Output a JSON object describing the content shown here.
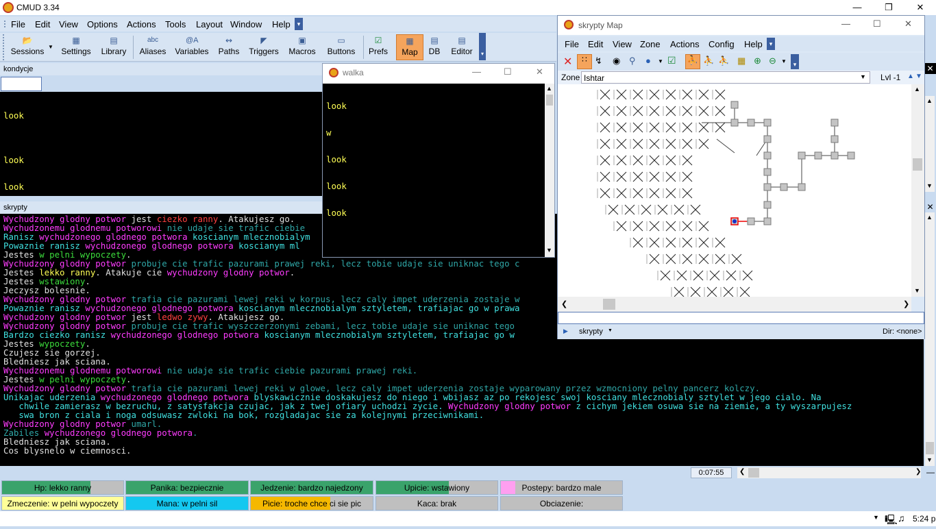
{
  "app": {
    "title": "CMUD 3.34"
  },
  "menu": [
    "File",
    "Edit",
    "View",
    "Options",
    "Actions",
    "Tools",
    "Layout",
    "Window",
    "Help"
  ],
  "toolbar": [
    {
      "label": "Sessions",
      "icon": "folder-icon"
    },
    {
      "label": "Settings",
      "icon": "settings-icon"
    },
    {
      "label": "Library",
      "icon": "library-icon"
    },
    {
      "label": "Aliases",
      "icon": "abc"
    },
    {
      "label": "Variables",
      "icon": "@A"
    },
    {
      "label": "Paths",
      "icon": "paths-icon"
    },
    {
      "label": "Triggers",
      "icon": "gun-icon"
    },
    {
      "label": "Macros",
      "icon": "key-icon"
    },
    {
      "label": "Buttons",
      "icon": "button-icon"
    },
    {
      "label": "Prefs",
      "icon": "check-icon"
    },
    {
      "label": "Map",
      "icon": "map-icon",
      "active": true
    },
    {
      "label": "DB",
      "icon": "db-icon"
    },
    {
      "label": "Editor",
      "icon": "editor-icon"
    }
  ],
  "kondycje": {
    "title": "kondycje",
    "lines": [
      "look",
      "",
      "look",
      "look",
      "look"
    ]
  },
  "walka": {
    "title": "walka",
    "lines": [
      "look",
      "w",
      "look",
      "look",
      "look"
    ]
  },
  "skrypty": {
    "title": "skrypty",
    "lines": [
      [
        [
          "m",
          "Wychudzony glodny potwor"
        ],
        [
          "w",
          " jest "
        ],
        [
          "r",
          "ciezko ranny"
        ],
        [
          "w",
          ". Atakujesz go."
        ]
      ],
      [
        [
          "m",
          "Wychudzonemu glodnemu potworowi"
        ],
        [
          "dc",
          " nie udaje sie trafic ciebie"
        ]
      ],
      [
        [
          "c",
          "Ranisz "
        ],
        [
          "m",
          "wychudzonego glodnego potwora"
        ],
        [
          "c",
          " koscianym mlecznobialym"
        ]
      ],
      [
        [
          "c",
          "Powaznie ranisz "
        ],
        [
          "m",
          "wychudzonego glodnego potwora"
        ],
        [
          "c",
          " koscianym ml"
        ]
      ],
      [
        [
          "w",
          "Jestes "
        ],
        [
          "g",
          "w pelni wypoczety"
        ],
        [
          "w",
          "."
        ]
      ],
      [
        [
          "m",
          "Wychudzony glodny potwor"
        ],
        [
          "dc",
          " probuje cie trafic pazurami prawej reki, lecz tobie udaje sie uniknac tego c"
        ]
      ],
      [
        [
          "w",
          "Jestes "
        ],
        [
          "y",
          "lekko ranny"
        ],
        [
          "w",
          ". Atakuje cie "
        ],
        [
          "m",
          "wychudzony glodny potwor"
        ],
        [
          "w",
          "."
        ]
      ],
      [
        [
          "w",
          "Jestes "
        ],
        [
          "g",
          "wstawiony"
        ],
        [
          "w",
          "."
        ]
      ],
      [
        [
          "w",
          "Jeczysz bolesnie."
        ]
      ],
      [
        [
          "m",
          "Wychudzony glodny potwor"
        ],
        [
          "dc",
          " trafia cie pazurami lewej reki w korpus, lecz caly impet uderzenia zostaje w"
        ]
      ],
      [
        [
          "c",
          "Powaznie ranisz "
        ],
        [
          "m",
          "wychudzonego glodnego potwora"
        ],
        [
          "c",
          " koscianym mlecznobialym sztyletem, trafiajac go w prawa"
        ]
      ],
      [
        [
          "m",
          "Wychudzony glodny potwor"
        ],
        [
          "w",
          " jest "
        ],
        [
          "r",
          "ledwo zywy"
        ],
        [
          "w",
          ". Atakujesz go."
        ]
      ],
      [
        [
          "m",
          "Wychudzony glodny potwor"
        ],
        [
          "dc",
          " probuje cie trafic wyszczerzonymi zebami, lecz tobie udaje sie uniknac tego "
        ]
      ],
      [
        [
          "c",
          "Bardzo ciezko ranisz "
        ],
        [
          "m",
          "wychudzonego glodnego potwora"
        ],
        [
          "c",
          " koscianym mlecznobialym sztyletem, trafiajac go w "
        ]
      ],
      [
        [
          "w",
          "Jestes "
        ],
        [
          "g",
          "wypoczety"
        ],
        [
          "w",
          "."
        ]
      ],
      [
        [
          "w",
          "Czujesz sie gorzej."
        ]
      ],
      [
        [
          "w",
          "Bledniesz jak sciana."
        ]
      ],
      [
        [
          "m",
          "Wychudzonemu glodnemu potworowi"
        ],
        [
          "dc",
          " nie udaje sie trafic ciebie pazurami prawej reki."
        ]
      ],
      [
        [
          "w",
          "Jestes "
        ],
        [
          "g",
          "w pelni wypoczety"
        ],
        [
          "w",
          "."
        ]
      ],
      [
        [
          "m",
          "Wychudzony glodny potwor"
        ],
        [
          "dc",
          " trafia cie pazurami lewej reki w glowe, lecz caly impet uderzenia zostaje wyparowany przez wzmocniony pelny pancerz kolczy."
        ]
      ],
      [
        [
          "c",
          "Unikajac uderzenia "
        ],
        [
          "m",
          "wychudzonego glodnego potwora"
        ],
        [
          "c",
          " blyskawicznie doskakujesz do niego i wbijasz az po rekojesc swoj kosciany mlecznobialy sztylet w jego cialo. Na"
        ]
      ],
      [
        [
          "c",
          "   chwile zamierasz w bezruchu, z satysfakcja czujac, jak z twej ofiary uchodzi zycie. "
        ],
        [
          "m",
          "Wychudzony glodny potwor"
        ],
        [
          "c",
          " z cichym jekiem osuwa sie na ziemie, a ty wyszarpujesz"
        ]
      ],
      [
        [
          "c",
          "   swa bron z ciala i noga odsuwasz zwloki na bok, rozgladajac sie za kolejnymi przeciwnikami."
        ]
      ],
      [
        [
          "m",
          "Wychudzony glodny potwor"
        ],
        [
          "dc",
          " umarl."
        ]
      ],
      [
        [
          "dc",
          "Zabiles "
        ],
        [
          "m",
          "wychudzonego glodnego potwora"
        ],
        [
          "dc",
          "."
        ]
      ],
      [
        [
          "w",
          "Bledniesz jak sciana."
        ]
      ],
      [
        [
          "w",
          "Cos blysnelo w ciemnosci."
        ]
      ]
    ]
  },
  "timer": "0:07:55",
  "status_row1": [
    {
      "text": "Hp: lekko ranny",
      "color": "#3aa36b",
      "fill": 0.73
    },
    {
      "text": "Panika: bezpiecznie",
      "color": "#3aa36b",
      "fill": 1.0
    },
    {
      "text": "Jedzenie: bardzo najedzony",
      "color": "#3aa36b",
      "fill": 1.0
    },
    {
      "text": "Upicie: wstawiony",
      "color": "#3aa36b",
      "fill": 0.6
    },
    {
      "text": "Postepy: bardzo male",
      "color": "#ff9ff0",
      "fill": 0.12
    }
  ],
  "status_row2": [
    {
      "text": "Zmeczenie: w pelni wypoczety",
      "color": "#ffff99",
      "fill": 1.0
    },
    {
      "text": "Mana: w pelni sil",
      "color": "#14c8f0",
      "fill": 1.0
    },
    {
      "text": "Picie: troche chce ci sie pic",
      "color": "#f5b800",
      "fill": 0.65
    },
    {
      "text": "Kaca: brak",
      "color": "#bfbfbf",
      "fill": 1.0
    },
    {
      "text": "Obciazenie:",
      "color": "#bfbfbf",
      "fill": 1.0
    }
  ],
  "map": {
    "title": "skrypty Map",
    "menu": [
      "File",
      "Edit",
      "View",
      "Zone",
      "Actions",
      "Config",
      "Help"
    ],
    "zone_label": "Zone",
    "zone_value": "Ishtar",
    "lvl": "Lvl -1",
    "footer_session": "skrypty",
    "footer_dir": "Dir: <none>"
  },
  "tray": {
    "time": "5:24 p"
  }
}
